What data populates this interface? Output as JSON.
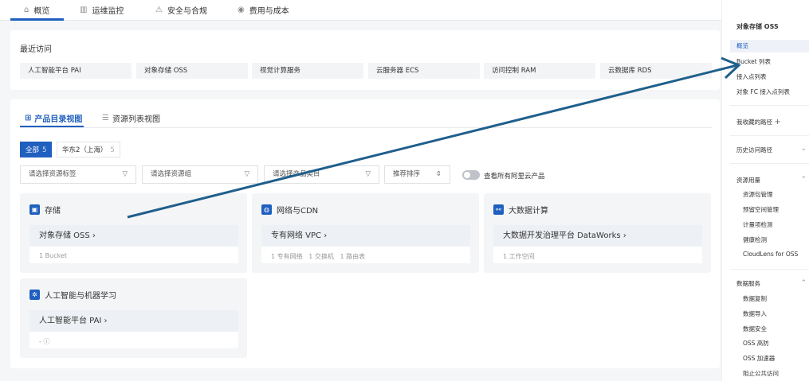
{
  "top_tabs": [
    {
      "label": "概览",
      "icon": "home-icon"
    },
    {
      "label": "运维监控",
      "icon": "chart-icon"
    },
    {
      "label": "安全与合规",
      "icon": "warning-icon"
    },
    {
      "label": "费用与成本",
      "icon": "cost-icon"
    }
  ],
  "recent": {
    "title": "最近访问",
    "items": [
      "人工智能平台 PAI",
      "对象存储 OSS",
      "视觉计算服务",
      "云服务器 ECS",
      "访问控制 RAM",
      "云数据库 RDS"
    ]
  },
  "view_tabs": [
    "产品目录视图",
    "资源列表视图"
  ],
  "regions": [
    {
      "label": "全部",
      "count": "5"
    },
    {
      "label": "华东2（上海）",
      "count": "5"
    }
  ],
  "filters": {
    "tag": "请选择资源标签",
    "group": "请选择资源组",
    "category": "请选择产品类目",
    "sort": "推荐排序",
    "toggle_label": "查看所有阿里云产品"
  },
  "products": [
    {
      "category": "存储",
      "name": "对象存储 OSS",
      "stats": "1 Bucket"
    },
    {
      "category": "网络与CDN",
      "name": "专有网络 VPC",
      "stats": "1 专有网络   1 交换机   1 路由表"
    },
    {
      "category": "大数据计算",
      "name": "大数据开发治理平台 DataWorks",
      "stats": "1 工作空间"
    },
    {
      "category": "人工智能与机器学习",
      "name": "人工智能平台 PAI",
      "stats": "-"
    }
  ],
  "sidebar": {
    "title": "对象存储 OSS",
    "items": [
      "概览",
      "Bucket 列表",
      "接入点列表",
      "对象 FC 接入点列表"
    ],
    "favorites": "我收藏的路径",
    "history": "历史访问路径",
    "usage": {
      "title": "资源用量",
      "items": [
        "资源包管理",
        "预留空间管理",
        "计量项检测",
        "健康检测",
        "CloudLens for OSS"
      ]
    },
    "data_services": {
      "title": "数据服务",
      "items": [
        "数据复制",
        "数据导入",
        "数据安全",
        "OSS 高防",
        "OSS 加速器",
        "阻止公共访问"
      ]
    }
  },
  "colors": {
    "accent": "#1f5fbf",
    "arrow": "#1f5f8b"
  }
}
